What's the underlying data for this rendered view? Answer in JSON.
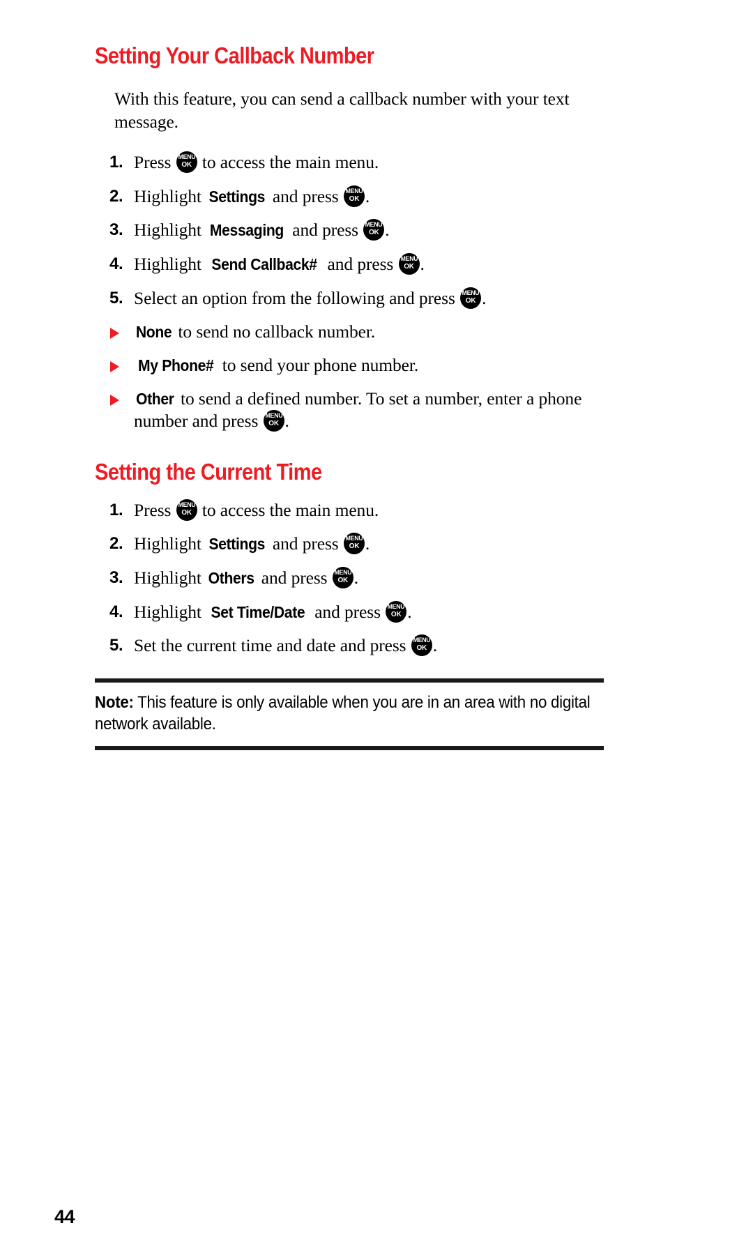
{
  "page": {
    "number": "44",
    "accent_color": "#ed1c24",
    "text_color": "#000000"
  },
  "key_icon": {
    "top_label": "MENU",
    "bottom_label": "OK",
    "name": "menu-ok-key-icon"
  },
  "sections": [
    {
      "heading": "Setting Your Callback Number",
      "intro": "With this feature, you can send a callback number with your text message.",
      "steps": [
        {
          "number": "1.",
          "parts": [
            {
              "type": "text",
              "value": "Press "
            },
            {
              "type": "key"
            },
            {
              "type": "text",
              "value": " to access the main menu."
            }
          ]
        },
        {
          "number": "2.",
          "parts": [
            {
              "type": "text",
              "value": "Highlight "
            },
            {
              "type": "bold",
              "value": "Settings"
            },
            {
              "type": "text",
              "value": " and press "
            },
            {
              "type": "key"
            },
            {
              "type": "text",
              "value": "."
            }
          ]
        },
        {
          "number": "3.",
          "parts": [
            {
              "type": "text",
              "value": "Highlight "
            },
            {
              "type": "bold",
              "value": "Messaging"
            },
            {
              "type": "text",
              "value": " and press "
            },
            {
              "type": "key"
            },
            {
              "type": "text",
              "value": "."
            }
          ]
        },
        {
          "number": "4.",
          "parts": [
            {
              "type": "text",
              "value": "Highlight "
            },
            {
              "type": "bold",
              "value": "Send Callback#"
            },
            {
              "type": "text",
              "value": " and press "
            },
            {
              "type": "key"
            },
            {
              "type": "text",
              "value": "."
            }
          ]
        },
        {
          "number": "5.",
          "parts": [
            {
              "type": "text",
              "value": "Select an option from the following and press "
            },
            {
              "type": "key"
            },
            {
              "type": "text",
              "value": "."
            }
          ]
        }
      ],
      "options": [
        {
          "bullet": "red-triangle",
          "parts": [
            {
              "type": "bold",
              "value": "None"
            },
            {
              "type": "text",
              "value": " to send no callback number."
            }
          ]
        },
        {
          "bullet": "red-triangle",
          "parts": [
            {
              "type": "bold",
              "value": "My Phone#"
            },
            {
              "type": "text",
              "value": " to send your phone number."
            }
          ]
        },
        {
          "bullet": "red-triangle",
          "parts": [
            {
              "type": "bold",
              "value": "Other"
            },
            {
              "type": "text",
              "value": " to send a defined number. To set a number, enter a phone number and press "
            },
            {
              "type": "key"
            },
            {
              "type": "text",
              "value": "."
            }
          ]
        }
      ]
    },
    {
      "heading": "Setting the Current Time",
      "intro": null,
      "steps": [
        {
          "number": "1.",
          "parts": [
            {
              "type": "text",
              "value": "Press "
            },
            {
              "type": "key"
            },
            {
              "type": "text",
              "value": " to access the main menu."
            }
          ]
        },
        {
          "number": "2.",
          "parts": [
            {
              "type": "text",
              "value": "Highlight "
            },
            {
              "type": "bold",
              "value": "Settings"
            },
            {
              "type": "text",
              "value": " and press "
            },
            {
              "type": "key"
            },
            {
              "type": "text",
              "value": "."
            }
          ]
        },
        {
          "number": "3.",
          "parts": [
            {
              "type": "text",
              "value": "Highlight "
            },
            {
              "type": "bold",
              "value": "Others"
            },
            {
              "type": "text",
              "value": " and press "
            },
            {
              "type": "key"
            },
            {
              "type": "text",
              "value": "."
            }
          ]
        },
        {
          "number": "4.",
          "parts": [
            {
              "type": "text",
              "value": "Highlight "
            },
            {
              "type": "bold",
              "value": "Set Time/Date"
            },
            {
              "type": "text",
              "value": " and press "
            },
            {
              "type": "key"
            },
            {
              "type": "text",
              "value": "."
            }
          ]
        },
        {
          "number": "5.",
          "parts": [
            {
              "type": "text",
              "value": "Set the current time and date and press "
            },
            {
              "type": "key"
            },
            {
              "type": "text",
              "value": "."
            }
          ]
        }
      ],
      "options": []
    }
  ],
  "note": {
    "label": "Note:",
    "text": " This feature is only available when you are in an area with no digital network available."
  }
}
